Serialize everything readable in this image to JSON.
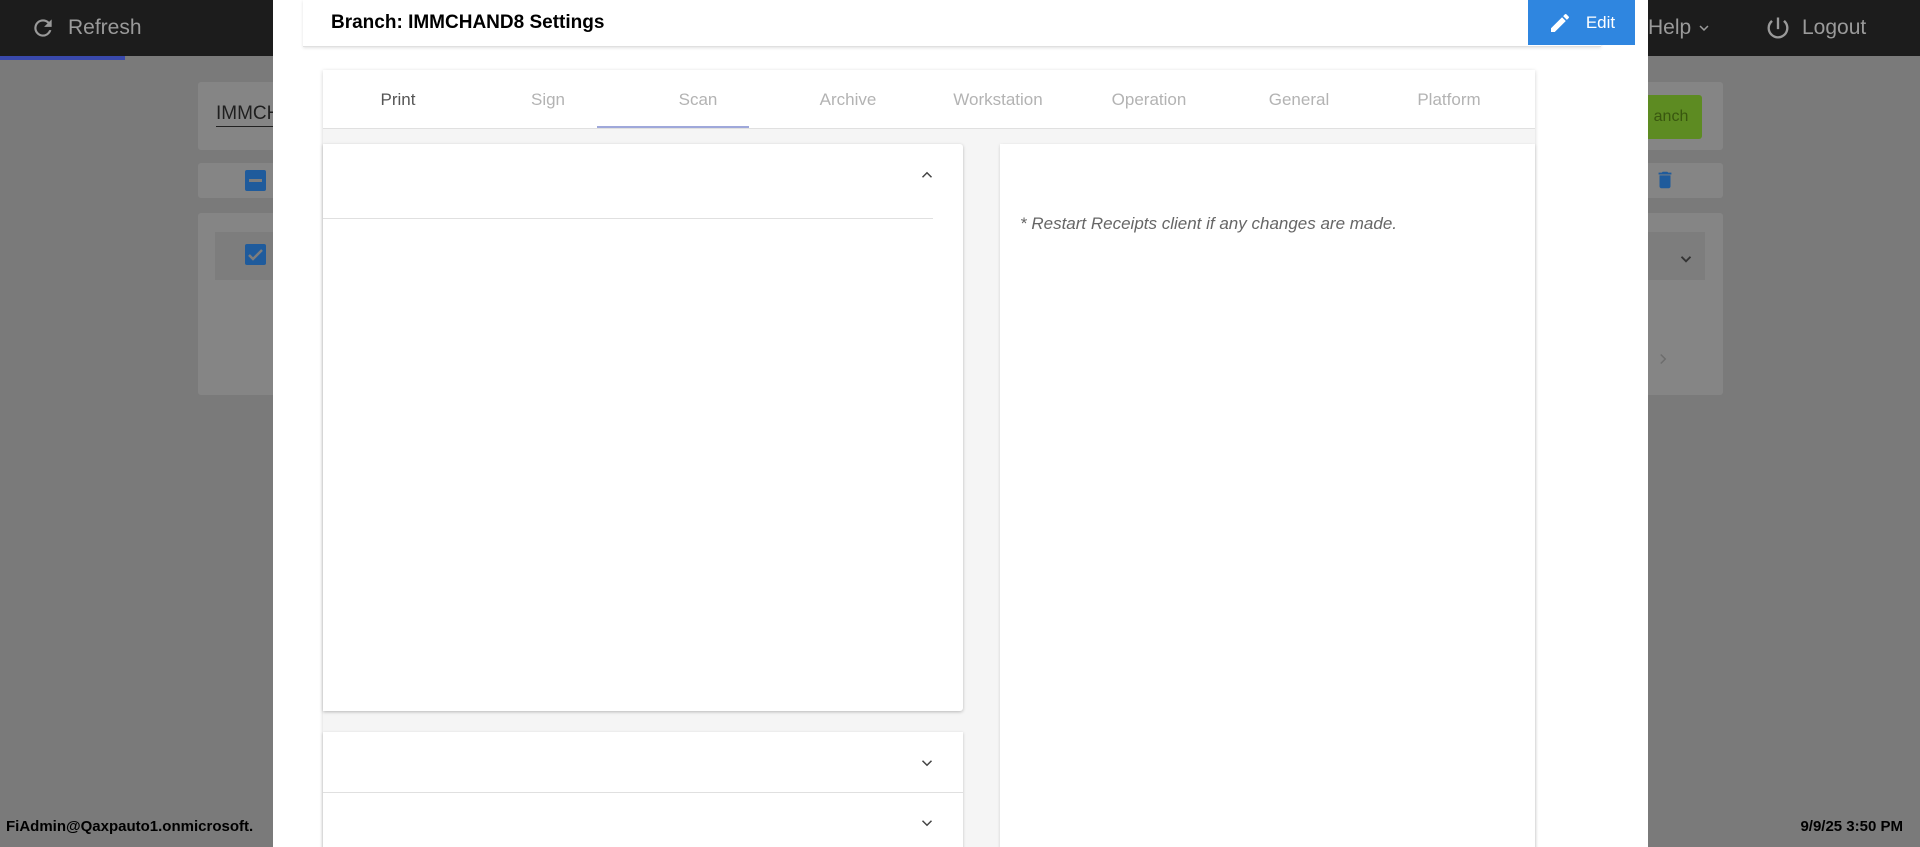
{
  "background": {
    "refresh_label": "Refresh",
    "help_label": "Help",
    "logout_label": "Logout",
    "search_value": "IMMCH",
    "green_button_label": "anch"
  },
  "modal": {
    "title": "Branch: IMMCHAND8 Settings",
    "edit_label": "Edit",
    "tabs": [
      {
        "label": "Print"
      },
      {
        "label": "Sign"
      },
      {
        "label": "Scan"
      },
      {
        "label": "Archive"
      },
      {
        "label": "Workstation"
      },
      {
        "label": "Operation"
      },
      {
        "label": "General"
      },
      {
        "label": "Platform"
      }
    ],
    "active_tab": "Scan",
    "restart_note": "* Restart Receipts client if any changes are made."
  },
  "status_bar": {
    "user": "FiAdmin@Qaxpauto1.onmicrosoft.",
    "datetime": "9/9/25 3:50 PM"
  },
  "colors": {
    "accent": "#2f86e0",
    "tab_underline": "#9fa8da",
    "topbar": "#1c1c1c"
  }
}
